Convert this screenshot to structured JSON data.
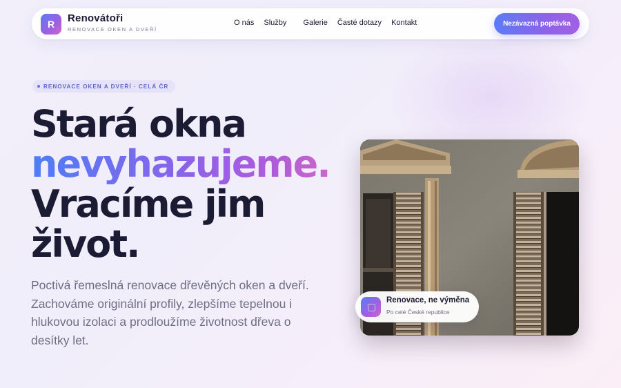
{
  "brand": {
    "logo_letter": "R",
    "name": "Renovátoři",
    "tagline": "RENOVACE OKEN A DVEŘÍ"
  },
  "nav": {
    "links": [
      "O nás",
      "Služby",
      "Galerie",
      "Časté dotazy",
      "Kontakt"
    ],
    "cta_label": "Nezávazná poptávka"
  },
  "hero": {
    "badge": "RENOVACE OKEN A DVEŘÍ · CELÁ ČR",
    "headline_line1": "Stará okna",
    "headline_line2": "nevyhazujeme.",
    "headline_line3": "Vracíme jim",
    "headline_line4": "život.",
    "lead": "Poctivá řemeslná renovace dřevěných oken a dveří. Zachováme originální profily, zlepšíme tepelnou i hlukovou izolaci a prodloužíme životnost dřeva o desítky let."
  },
  "photo_card": {
    "label_title": "Renovace, ne výměna",
    "label_subtitle": "Po celé České republice"
  },
  "colors": {
    "accent_start": "#5b7cf5",
    "accent_end": "#d067c8",
    "text_dark": "#1c1b34",
    "text_muted": "#6f6e86"
  }
}
